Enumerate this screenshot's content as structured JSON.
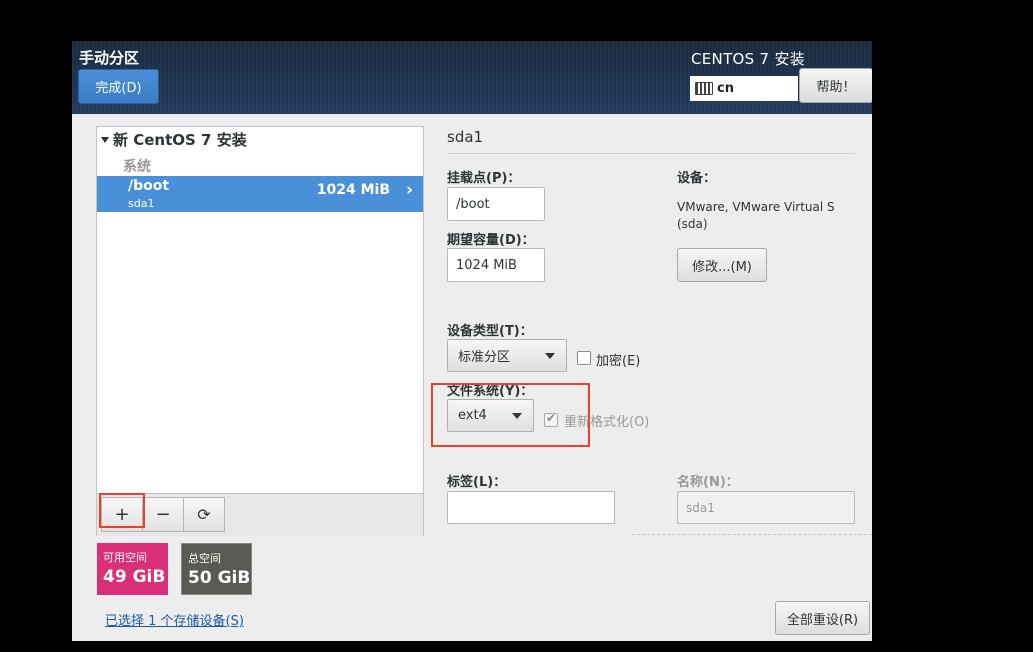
{
  "header": {
    "title": "手动分区",
    "done_label": "完成(D)",
    "install_title": "CENTOS 7 安装",
    "keyboard_layout": "cn",
    "help_label": "帮助！"
  },
  "tree": {
    "group_title": "新 CentOS 7 安装",
    "section_label": "系统",
    "partitions": [
      {
        "mount": "/boot",
        "device": "sda1",
        "size": "1024 MiB",
        "selected": true
      }
    ]
  },
  "toolbar": {
    "add_label": "+",
    "remove_label": "−",
    "refresh_label": "⟳"
  },
  "space": {
    "available_label": "可用空间",
    "available_value": "49 GiB",
    "available_color": "#d92e78",
    "total_label": "总空间",
    "total_value": "50 GiB",
    "total_color": "#5a5a52"
  },
  "storage_link": "已选择 1 个存储设备(S)",
  "details": {
    "title": "sda1",
    "mount_label": "挂载点(P)：",
    "mount_value": "/boot",
    "capacity_label": "期望容量(D)：",
    "capacity_value": "1024 MiB",
    "device_label": "设备：",
    "device_desc": "VMware, VMware Virtual S",
    "device_id": "(sda)",
    "modify_label": "修改...(M)",
    "device_type_label": "设备类型(T)：",
    "device_type_value": "标准分区",
    "encrypt_label": "加密(E)",
    "filesystem_label": "文件系统(Y)：",
    "filesystem_value": "ext4",
    "reformat_label": "重新格式化(O)",
    "tag_label": "标签(L)：",
    "tag_value": "",
    "name_label": "名称(N)：",
    "name_placeholder": "sda1",
    "reset_label": "全部重设(R)"
  },
  "highlight_color": "#e8412c"
}
